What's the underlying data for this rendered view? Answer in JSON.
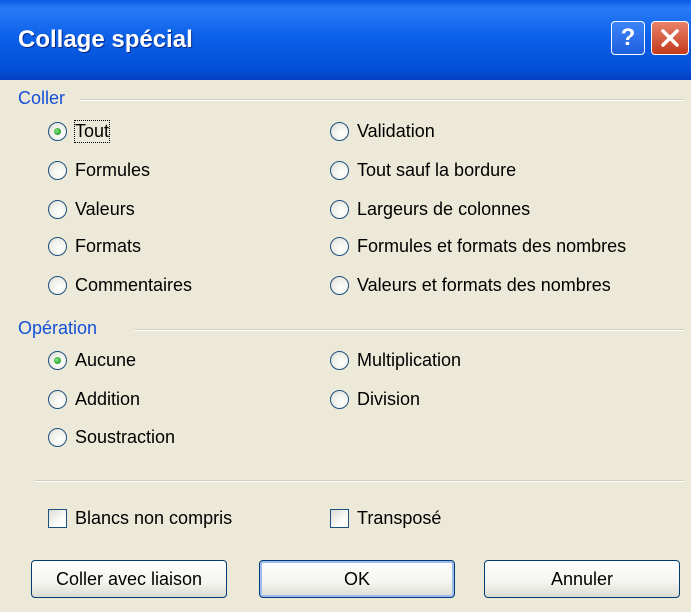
{
  "window": {
    "title": "Collage spécial",
    "help_glyph": "?",
    "close_icon": "close-icon"
  },
  "coller": {
    "label": "Coller",
    "options_left": [
      {
        "label": "Tout",
        "selected": true
      },
      {
        "label": "Formules",
        "selected": false
      },
      {
        "label": "Valeurs",
        "selected": false
      },
      {
        "label": "Formats",
        "selected": false
      },
      {
        "label": "Commentaires",
        "selected": false
      }
    ],
    "options_right": [
      {
        "label": "Validation",
        "selected": false
      },
      {
        "label": "Tout sauf la bordure",
        "selected": false
      },
      {
        "label": "Largeurs de colonnes",
        "selected": false
      },
      {
        "label": "Formules et formats des nombres",
        "selected": false
      },
      {
        "label": "Valeurs et formats des nombres",
        "selected": false
      }
    ]
  },
  "operation": {
    "label": "Opération",
    "options_left": [
      {
        "label": "Aucune",
        "selected": true
      },
      {
        "label": "Addition",
        "selected": false
      },
      {
        "label": "Soustraction",
        "selected": false
      }
    ],
    "options_right": [
      {
        "label": "Multiplication",
        "selected": false
      },
      {
        "label": "Division",
        "selected": false
      }
    ]
  },
  "checkboxes": {
    "skip_blanks": {
      "label": "Blancs non compris",
      "checked": false
    },
    "transpose": {
      "label": "Transposé",
      "checked": false
    }
  },
  "buttons": {
    "paste_link": "Coller avec liaison",
    "ok": "OK",
    "cancel": "Annuler"
  },
  "colors": {
    "titlebar": "#0550d8",
    "group_label": "#1550d8",
    "dialog_bg": "#ece9d8",
    "radio_selected": "#21a121",
    "close_button": "#c43a1c"
  }
}
